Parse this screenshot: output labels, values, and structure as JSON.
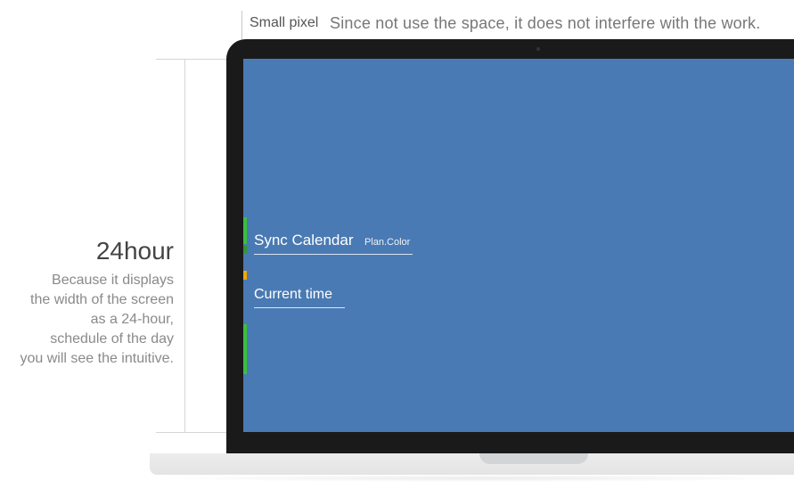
{
  "top": {
    "small_label": "Small pixel",
    "description": "Since not use the space, it does not interfere with the work."
  },
  "left": {
    "title": "24hour",
    "body": "Because it displays\nthe width of the screen\nas a 24-hour,\nschedule of the day\nyou will see the intuitive."
  },
  "screen": {
    "sync_label": "Sync Calendar",
    "sync_sub": "Plan.Color",
    "current_time_label": "Current time"
  },
  "colors": {
    "screen_bg": "#4a7ab3",
    "bar_green": "#3bbf3b",
    "bar_amber": "#f0a800"
  }
}
